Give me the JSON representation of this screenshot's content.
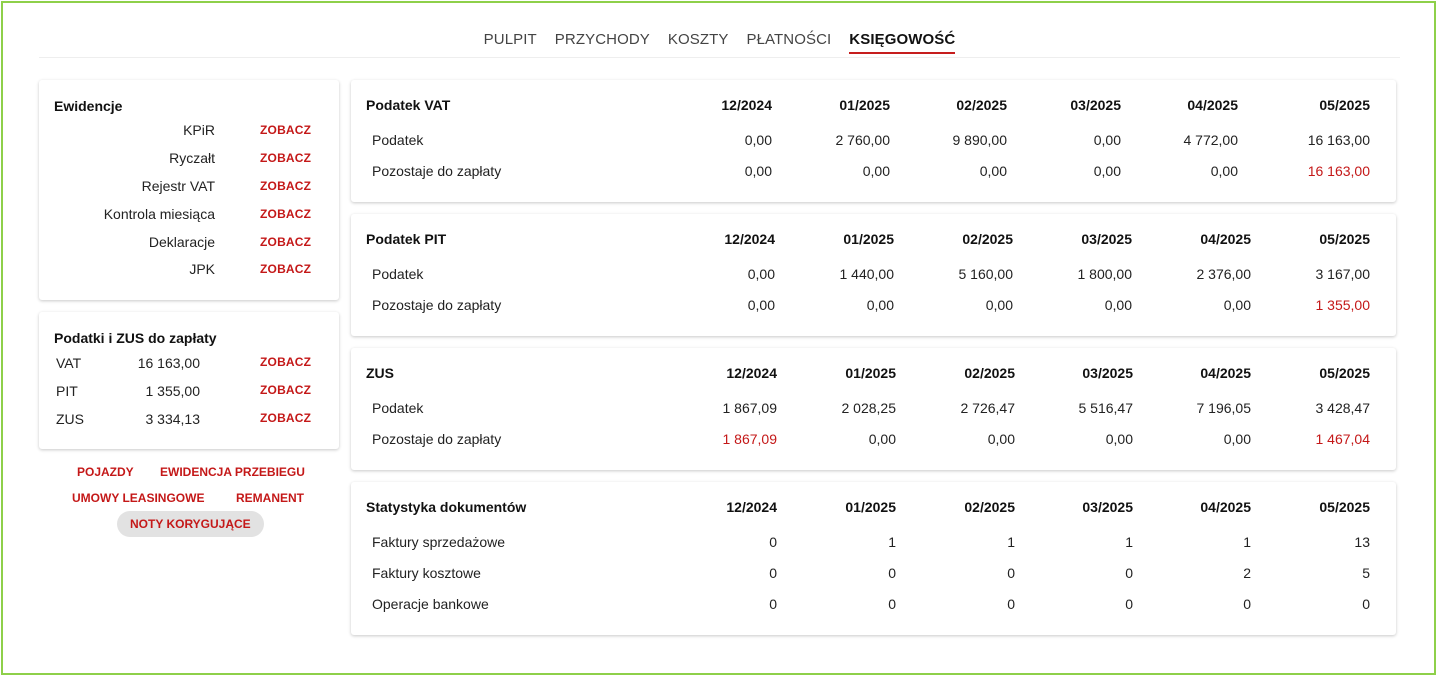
{
  "nav": {
    "tabs": [
      {
        "label": "PULPIT",
        "active": false
      },
      {
        "label": "PRZYCHODY",
        "active": false
      },
      {
        "label": "KOSZTY",
        "active": false
      },
      {
        "label": "PŁATNOŚCI",
        "active": false
      },
      {
        "label": "KSIĘGOWOŚĆ",
        "active": true
      }
    ]
  },
  "ewidencje": {
    "title": "Ewidencje",
    "items": [
      {
        "label": "KPiR",
        "link": "ZOBACZ"
      },
      {
        "label": "Ryczałt",
        "link": "ZOBACZ"
      },
      {
        "label": "Rejestr VAT",
        "link": "ZOBACZ"
      },
      {
        "label": "Kontrola miesiąca",
        "link": "ZOBACZ"
      },
      {
        "label": "Deklaracje",
        "link": "ZOBACZ"
      },
      {
        "label": "JPK",
        "link": "ZOBACZ"
      }
    ]
  },
  "podatki": {
    "title": "Podatki i ZUS do zapłaty",
    "items": [
      {
        "label": "VAT",
        "value": "16 163,00",
        "link": "ZOBACZ"
      },
      {
        "label": "PIT",
        "value": "1 355,00",
        "link": "ZOBACZ"
      },
      {
        "label": "ZUS",
        "value": "3 334,13",
        "link": "ZOBACZ"
      }
    ]
  },
  "extra_links": {
    "pojazdy": "POJAZDY",
    "ewidencja_przebiegu": "EWIDENCJA PRZEBIEGU",
    "umowy_leasingowe": "UMOWY LEASINGOWE",
    "remanent": "REMANENT",
    "noty_korygujace": "NOTY KORYGUJĄCE"
  },
  "colors": {
    "accent": "#c41818",
    "frame": "#8ed04a"
  },
  "tables": [
    {
      "title": "Podatek VAT",
      "months": [
        "12/2024",
        "01/2025",
        "02/2025",
        "03/2025",
        "04/2025",
        "05/2025"
      ],
      "rows": [
        {
          "label": "Podatek",
          "values": [
            "0,00",
            "2 760,00",
            "9 890,00",
            "0,00",
            "4 772,00",
            "16 163,00"
          ],
          "red": [
            false,
            false,
            false,
            false,
            false,
            false
          ]
        },
        {
          "label": "Pozostaje do zapłaty",
          "values": [
            "0,00",
            "0,00",
            "0,00",
            "0,00",
            "0,00",
            "16 163,00"
          ],
          "red": [
            false,
            false,
            false,
            false,
            false,
            true
          ]
        }
      ]
    },
    {
      "title": "Podatek PIT",
      "months": [
        "12/2024",
        "01/2025",
        "02/2025",
        "03/2025",
        "04/2025",
        "05/2025"
      ],
      "rows": [
        {
          "label": "Podatek",
          "values": [
            "0,00",
            "1 440,00",
            "5 160,00",
            "1 800,00",
            "2 376,00",
            "3 167,00"
          ],
          "red": [
            false,
            false,
            false,
            false,
            false,
            false
          ]
        },
        {
          "label": "Pozostaje do zapłaty",
          "values": [
            "0,00",
            "0,00",
            "0,00",
            "0,00",
            "0,00",
            "1 355,00"
          ],
          "red": [
            false,
            false,
            false,
            false,
            false,
            true
          ]
        }
      ]
    },
    {
      "title": "ZUS",
      "months": [
        "12/2024",
        "01/2025",
        "02/2025",
        "03/2025",
        "04/2025",
        "05/2025"
      ],
      "rows": [
        {
          "label": "Podatek",
          "values": [
            "1 867,09",
            "2 028,25",
            "2 726,47",
            "5 516,47",
            "7 196,05",
            "3 428,47"
          ],
          "red": [
            false,
            false,
            false,
            false,
            false,
            false
          ]
        },
        {
          "label": "Pozostaje do zapłaty",
          "values": [
            "1 867,09",
            "0,00",
            "0,00",
            "0,00",
            "0,00",
            "1 467,04"
          ],
          "red": [
            true,
            false,
            false,
            false,
            false,
            true
          ]
        }
      ]
    },
    {
      "title": "Statystyka dokumentów",
      "months": [
        "12/2024",
        "01/2025",
        "02/2025",
        "03/2025",
        "04/2025",
        "05/2025"
      ],
      "rows": [
        {
          "label": "Faktury sprzedażowe",
          "values": [
            "0",
            "1",
            "1",
            "1",
            "1",
            "13"
          ],
          "red": [
            false,
            false,
            false,
            false,
            false,
            false
          ]
        },
        {
          "label": "Faktury kosztowe",
          "values": [
            "0",
            "0",
            "0",
            "0",
            "2",
            "5"
          ],
          "red": [
            false,
            false,
            false,
            false,
            false,
            false
          ]
        },
        {
          "label": "Operacje bankowe",
          "values": [
            "0",
            "0",
            "0",
            "0",
            "0",
            "0"
          ],
          "red": [
            false,
            false,
            false,
            false,
            false,
            false
          ]
        }
      ]
    }
  ]
}
